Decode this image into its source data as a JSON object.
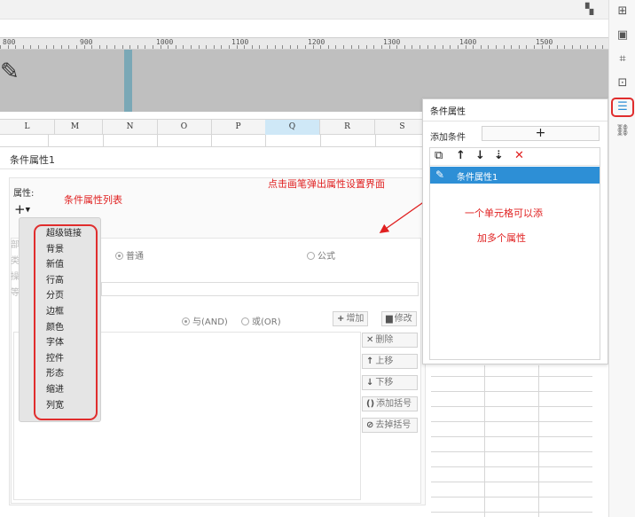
{
  "ruler": {
    "labels": [
      "800",
      "900",
      "1000",
      "1100",
      "1200",
      "1300",
      "1400",
      "1500"
    ]
  },
  "columns": [
    "L",
    "M",
    "N",
    "O",
    "P",
    "Q",
    "R",
    "S"
  ],
  "selected_column": "Q",
  "cond_panel": {
    "title": "条件属性1",
    "attr_label": "属性:",
    "plus": "+",
    "radio_normal": "普通",
    "radio_formula": "公式",
    "radio_and": "与(AND)",
    "radio_or": "或(OR)",
    "btn_add": "增加",
    "btn_edit": "修改",
    "btn_delete": "删除",
    "btn_up": "上移",
    "btn_down": "下移",
    "btn_add_paren": "添加括号",
    "btn_remove_paren": "去掉括号"
  },
  "dropdown": {
    "items": [
      "超级链接",
      "背景",
      "新值",
      "行高",
      "分页",
      "边框",
      "颜色",
      "字体",
      "控件",
      "形态",
      "缩进",
      "列宽"
    ]
  },
  "annotations": {
    "list_label": "条件属性列表",
    "pen_hint": "点击画笔弹出属性设置界面",
    "multi_line1": "一个单元格可以添",
    "multi_line2": "加多个属性"
  },
  "props_panel": {
    "title": "条件属性",
    "add_condition_label": "添加条件",
    "add_button": "+",
    "item_label": "条件属性1"
  },
  "colors": {
    "accent": "#2d8fd6",
    "annotation": "#e02020",
    "selected_column": "#cfe8f7"
  }
}
